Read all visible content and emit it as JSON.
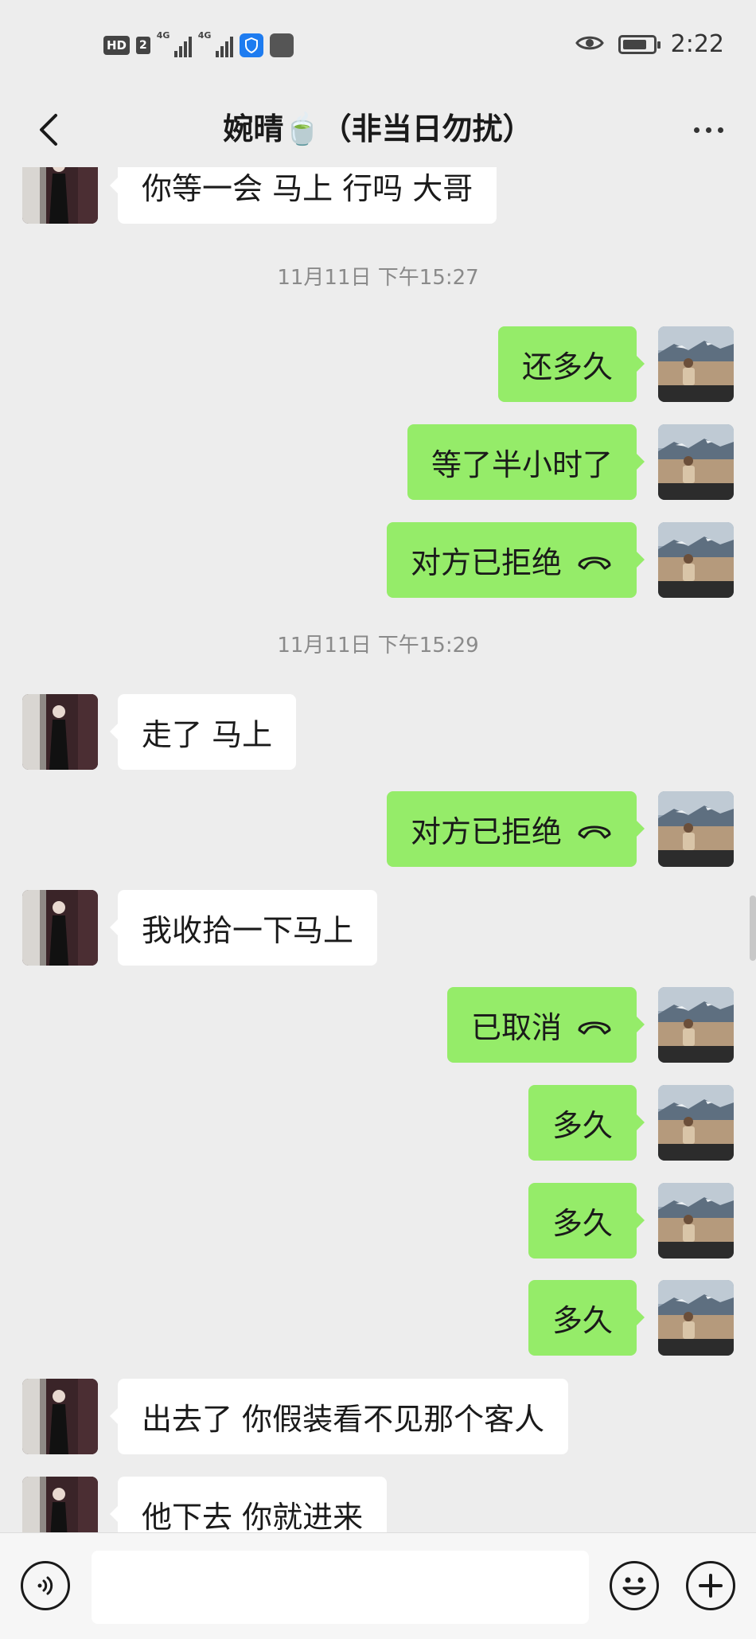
{
  "status_bar": {
    "network_badge": "HD",
    "sim_badge": "2",
    "signal_1_label": "4G",
    "signal_2_label": "4G",
    "time": "2:22"
  },
  "nav": {
    "title": "婉晴🍵（非当日勿扰）",
    "back_icon": "chevron-left-icon",
    "more_icon": "more-dots-icon"
  },
  "messages": [
    {
      "side": "in",
      "text": "你等一会 马上 行吗 大哥"
    },
    {
      "type": "time",
      "text": "11月11日 下午15:27"
    },
    {
      "side": "out",
      "text": "还多久"
    },
    {
      "side": "out",
      "text": "等了半小时了"
    },
    {
      "side": "out",
      "text": "对方已拒绝",
      "call": true
    },
    {
      "type": "time",
      "text": "11月11日 下午15:29"
    },
    {
      "side": "in",
      "text": "走了  马上"
    },
    {
      "side": "out",
      "text": "对方已拒绝",
      "call": true
    },
    {
      "side": "in",
      "text": "我收拾一下马上"
    },
    {
      "side": "out",
      "text": "已取消",
      "call": true
    },
    {
      "side": "out",
      "text": "多久"
    },
    {
      "side": "out",
      "text": "多久"
    },
    {
      "side": "out",
      "text": "多久"
    },
    {
      "side": "in",
      "text": "出去了 你假装看不见那个客人"
    },
    {
      "side": "in",
      "text": "他下去 你就进来"
    }
  ],
  "input_bar": {
    "voice_icon": "voice-icon",
    "text_value": "",
    "emoji_icon": "emoji-icon",
    "plus_icon": "plus-icon"
  },
  "colors": {
    "background": "#ededed",
    "outgoing_bubble": "#95ec69",
    "incoming_bubble": "#ffffff"
  }
}
